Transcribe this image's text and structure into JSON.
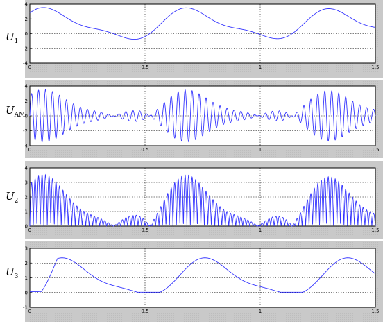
{
  "colors": {
    "signal": "#3434ff",
    "panel": "#c9c9c9",
    "plot_bg": "#ffffff"
  },
  "chart_data": [
    {
      "type": "line",
      "label_main": "U",
      "label_sub": "1",
      "xlim": [
        0,
        1.5
      ],
      "ylim": [
        -4,
        4
      ],
      "x_ticks": [
        "0",
        "0.5",
        "1",
        "1.5"
      ],
      "y_ticks": [
        "4",
        "2",
        "0",
        "-2",
        "-4"
      ],
      "grid": true,
      "series": [
        {
          "x_step": 0.0025,
          "formula": "smooth",
          "y": []
        }
      ],
      "kind": "u1"
    },
    {
      "type": "line",
      "label_main": "U",
      "label_sub": "AM",
      "xlim": [
        0,
        1.5
      ],
      "ylim": [
        -4,
        4
      ],
      "x_ticks": [
        "0",
        "0.5",
        "1",
        "1.5"
      ],
      "y_ticks": [
        "4",
        "2",
        "0",
        "-2",
        "-4"
      ],
      "grid": true,
      "kind": "uam"
    },
    {
      "type": "line",
      "label_main": "U",
      "label_sub": "2",
      "xlim": [
        0,
        1.5
      ],
      "ylim": [
        0,
        4
      ],
      "x_ticks": [
        "0",
        "0.5",
        "1",
        "1.5"
      ],
      "y_ticks": [
        "4",
        "3",
        "2",
        "1",
        "0"
      ],
      "grid": true,
      "kind": "u2"
    },
    {
      "type": "line",
      "label_main": "U",
      "label_sub": "3",
      "xlim": [
        0,
        1.5
      ],
      "ylim": [
        -1,
        3
      ],
      "x_ticks": [
        "0",
        "0.5",
        "1",
        "1.5"
      ],
      "y_ticks": [
        "3",
        "2",
        "1",
        "0",
        "-1"
      ],
      "grid": true,
      "kind": "u3"
    }
  ]
}
